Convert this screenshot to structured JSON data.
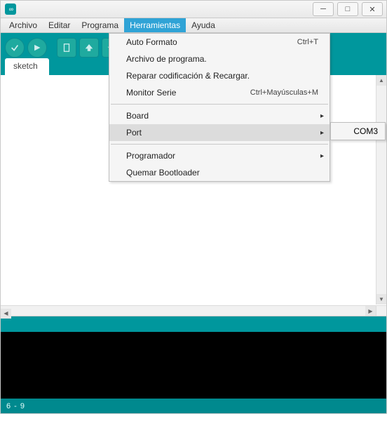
{
  "menubar": {
    "file": "Archivo",
    "edit": "Editar",
    "sketch": "Programa",
    "tools": "Herramientas",
    "help": "Ayuda"
  },
  "tab": {
    "name": "sketch"
  },
  "tools_menu": {
    "autoformat": {
      "label": "Auto Formato",
      "shortcut": "Ctrl+T"
    },
    "archive": {
      "label": "Archivo de programa."
    },
    "fixencoding": {
      "label": "Reparar codificación & Recargar."
    },
    "serialmonitor": {
      "label": "Monitor Serie",
      "shortcut": "Ctrl+Mayúsculas+M"
    },
    "board": {
      "label": "Board"
    },
    "port": {
      "label": "Port"
    },
    "programmer": {
      "label": "Programador"
    },
    "burn": {
      "label": "Quemar Bootloader"
    }
  },
  "port_submenu": {
    "com3": "COM3"
  },
  "status": {
    "cursor": "6 - 9"
  },
  "window_controls": {
    "minimize": "─",
    "maximize": "□",
    "close": "✕"
  }
}
